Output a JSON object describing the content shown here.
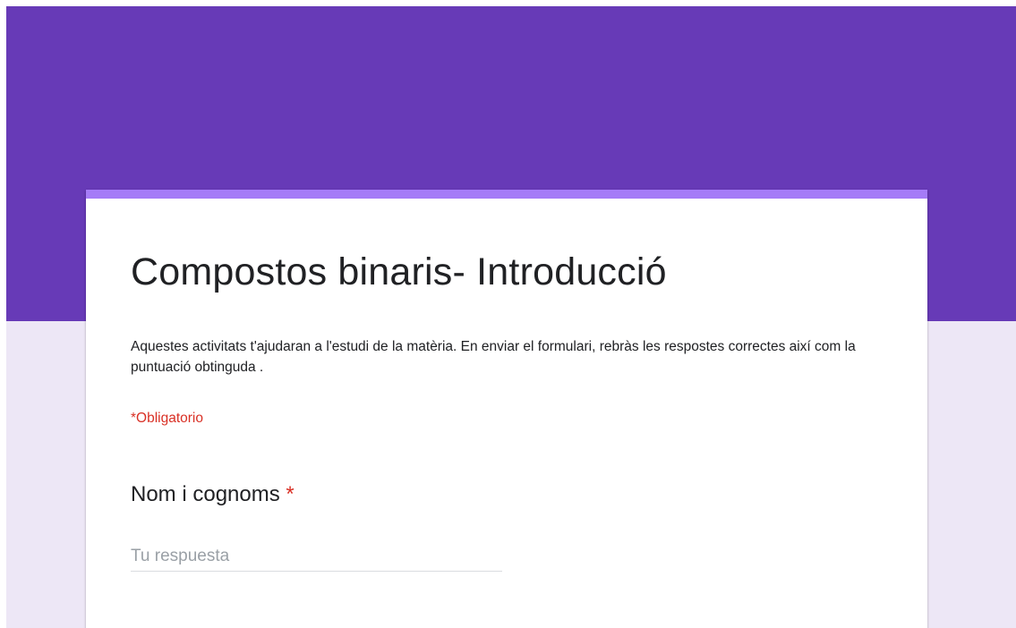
{
  "form": {
    "title": "Compostos binaris- Introducció",
    "description": "Aquestes activitats t'ajudaran a l'estudi de la matèria. En enviar el formulari, rebràs les respostes correctes així com la puntuació obtinguda .",
    "required_note": "*Obligatorio",
    "questions": [
      {
        "title": "Nom i cognoms",
        "required_marker": "*",
        "answer_placeholder": "Tu respuesta",
        "answer_value": ""
      }
    ]
  },
  "theme": {
    "header_color": "#673ab7",
    "accent_color": "#a57cf7",
    "background_color": "#ede7f6",
    "required_color": "#d93025"
  }
}
